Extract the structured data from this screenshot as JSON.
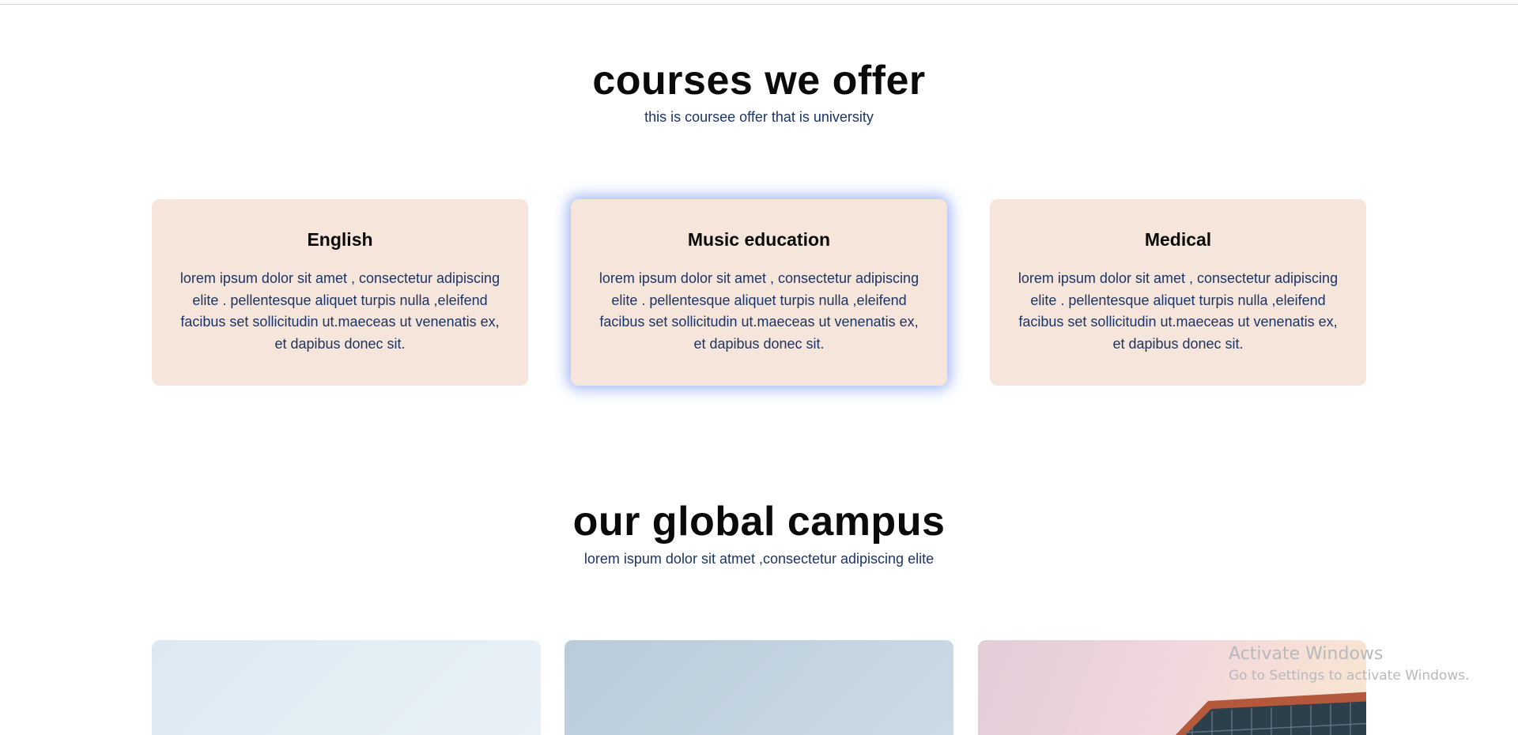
{
  "courses_section": {
    "title": "courses we offer",
    "subtitle": "this is coursee offer that is university",
    "cards": [
      {
        "heading": "English",
        "body": "lorem ipsum dolor sit amet , consectetur adipiscing elite . pellentesque aliquet turpis nulla ,eleifend facibus set sollicitudin ut.maeceas ut venenatis ex, et dapibus donec sit."
      },
      {
        "heading": "Music education",
        "body": "lorem ipsum dolor sit amet , consectetur adipiscing elite . pellentesque aliquet turpis nulla ,eleifend facibus set sollicitudin ut.maeceas ut venenatis ex, et dapibus donec sit."
      },
      {
        "heading": "Medical",
        "body": "lorem ipsum dolor sit amet , consectetur adipiscing elite . pellentesque aliquet turpis nulla ,eleifend facibus set sollicitudin ut.maeceas ut venenatis ex, et dapibus donec sit."
      }
    ]
  },
  "campus_section": {
    "title": "our global campus",
    "subtitle": "lorem ispum dolor sit atmet ,consectetur adipiscing elite"
  },
  "windows_watermark": {
    "title": "Activate Windows",
    "subtitle": "Go to Settings to activate Windows."
  },
  "colors": {
    "card_background": "#f5e5da",
    "body_text": "#1c3566",
    "heading_text": "#0a0a0a",
    "hover_glow": "#4d76e8"
  }
}
